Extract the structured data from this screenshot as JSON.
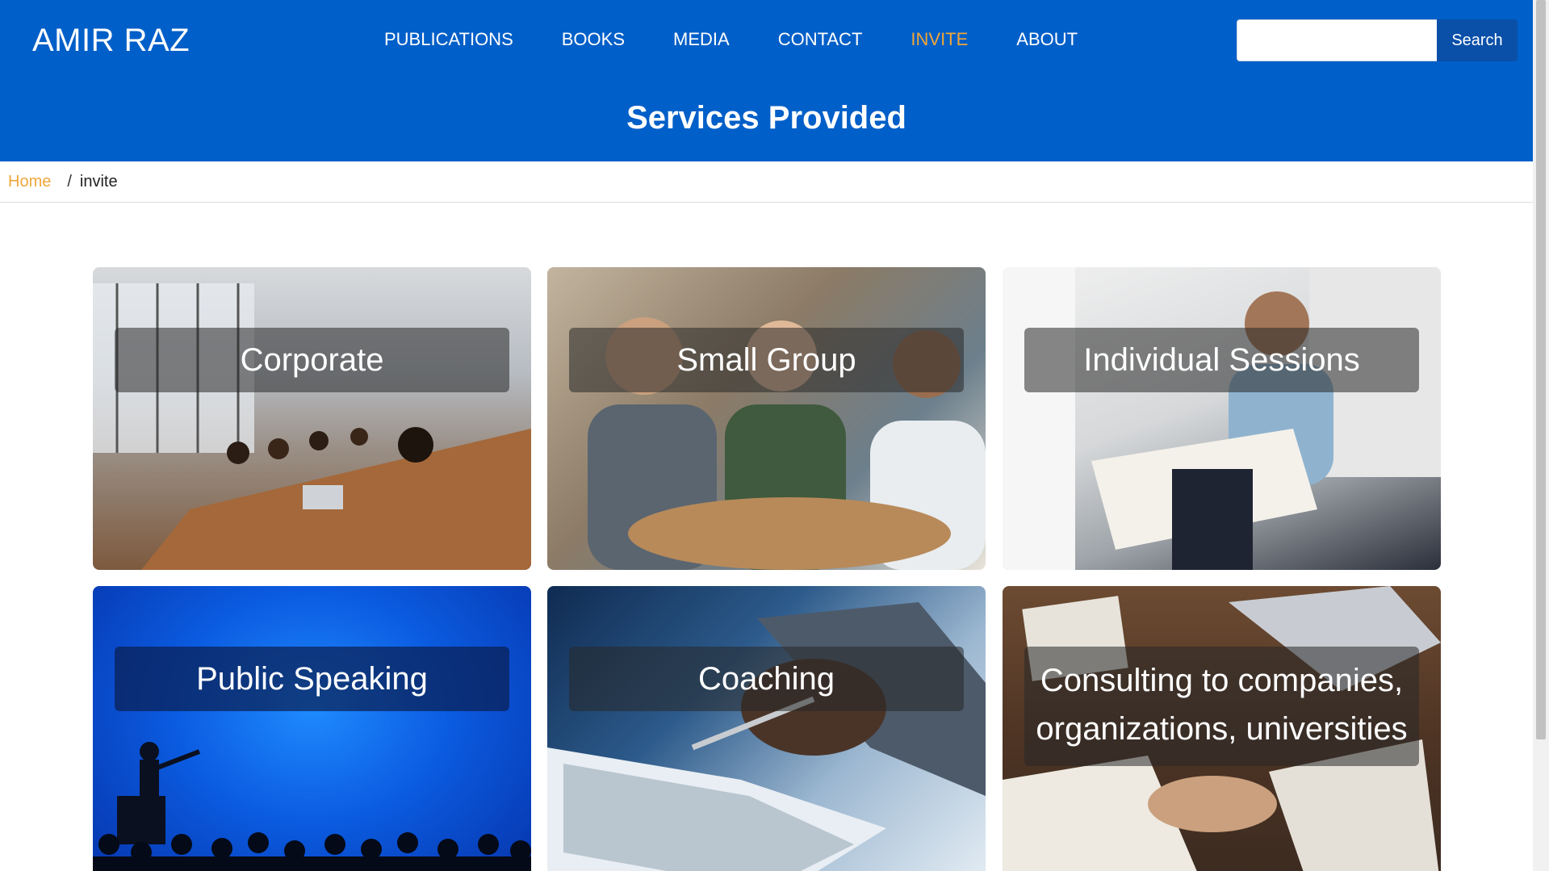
{
  "header": {
    "brand": "AMIR RAZ",
    "nav": [
      {
        "label": "PUBLICATIONS",
        "active": false
      },
      {
        "label": "BOOKS",
        "active": false
      },
      {
        "label": "MEDIA",
        "active": false
      },
      {
        "label": "CONTACT",
        "active": false
      },
      {
        "label": "INVITE",
        "active": true
      },
      {
        "label": "ABOUT",
        "active": false
      }
    ],
    "search": {
      "placeholder": "",
      "button_label": "Search"
    },
    "title": "Services Provided"
  },
  "breadcrumb": {
    "home": "Home",
    "separator": "/",
    "current": "invite"
  },
  "services": [
    {
      "label": "Corporate"
    },
    {
      "label": "Small Group"
    },
    {
      "label": "Individual Sessions"
    },
    {
      "label": "Public Speaking"
    },
    {
      "label": "Coaching"
    },
    {
      "label": "Consulting to companies, organizations, universities"
    }
  ],
  "colors": {
    "header_bg": "#005fc8",
    "accent": "#f0a63a",
    "search_button_bg": "#0a4fa8"
  }
}
